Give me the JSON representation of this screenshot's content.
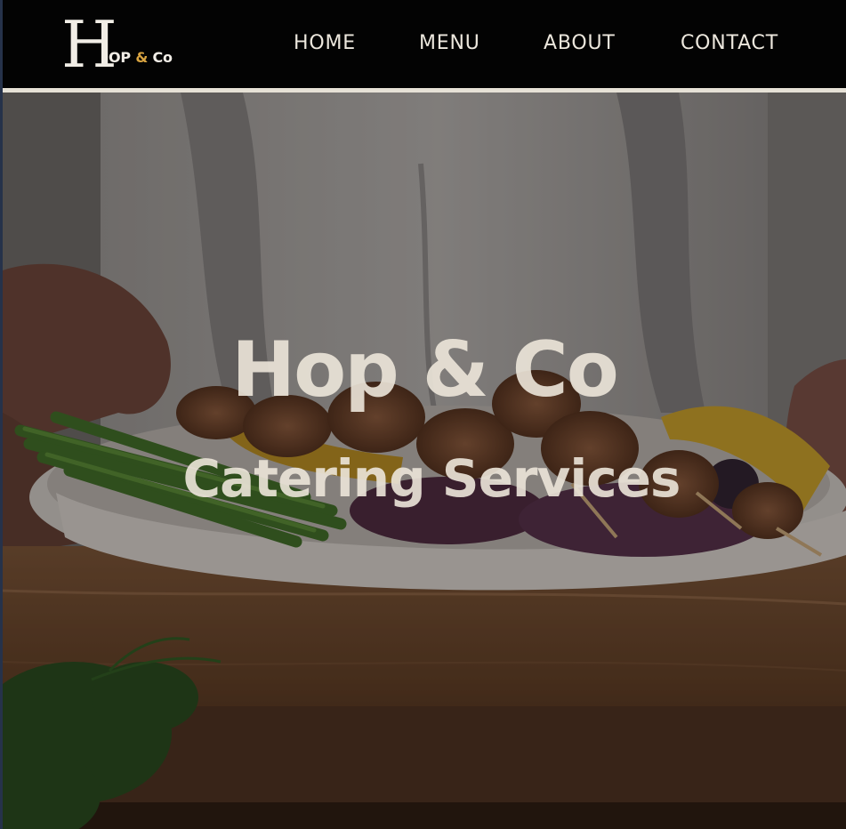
{
  "brand": {
    "logo_initial": "H",
    "logo_rest": "OP",
    "logo_amp": "&",
    "logo_co": "Co"
  },
  "nav": {
    "items": [
      {
        "label": "HOME"
      },
      {
        "label": "MENU"
      },
      {
        "label": "ABOUT"
      },
      {
        "label": "CONTACT"
      }
    ]
  },
  "hero": {
    "title": "Hop & Co",
    "subtitle": "Catering Services"
  },
  "colors": {
    "header_bg": "#030303",
    "header_rule": "#e6e1d6",
    "nav_text": "#ece7dd",
    "logo_accent": "#d9a441",
    "hero_text": "#ede6da"
  }
}
